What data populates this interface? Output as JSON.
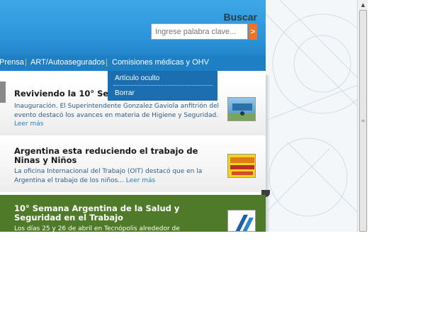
{
  "header": {
    "search_label": "Buscar",
    "search_placeholder": "Ingrese palabra clave...",
    "search_button": ">"
  },
  "nav": {
    "items": [
      "Prensa",
      "ART/Autoasegurados",
      "Comisiones médicas y OHV"
    ],
    "separator": "|"
  },
  "dropdown": {
    "items": [
      "Artículo oculto",
      "Borrar"
    ]
  },
  "news": [
    {
      "title": "Reviviendo la 10° Se",
      "text": "Inauguración. El Superintendente Gonzalez Gaviola anfitrión del evento destacó los avances en materia de Higiene y Seguridad.",
      "more": "Leer más"
    },
    {
      "title": "Argentina esta reduciendo el trabajo de Ninas y Niños",
      "text": "La oficina Internacional del Trabajo (OIT) destacó que en la Argentina el trabajo de los niños...",
      "more": "Leer más"
    },
    {
      "title": "10° Semana Argentina de la Salud y Seguridad en el Trabajo",
      "text": "Los días 25 y 26 de abril en Tecnópolis alrededor de",
      "more": ""
    }
  ],
  "colors": {
    "header_blue": "#2b93d9",
    "nav_blue": "#1f7fc4",
    "accent_orange": "#f07222",
    "highlight_green": "#4f7a2a"
  }
}
